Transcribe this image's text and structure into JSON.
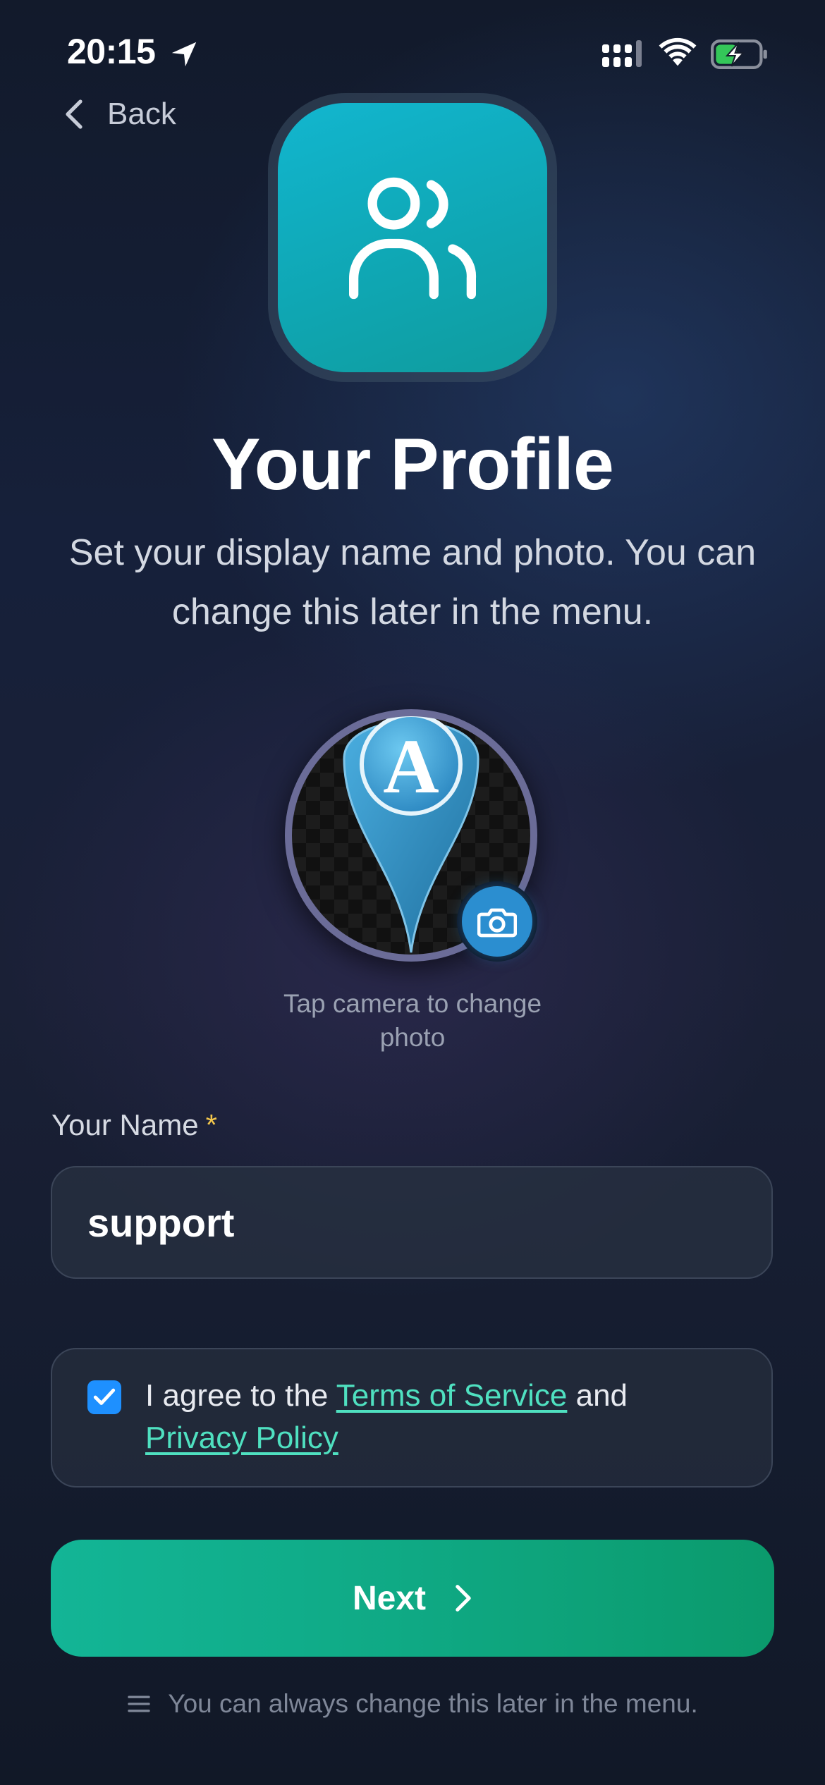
{
  "status_bar": {
    "time": "20:15"
  },
  "nav": {
    "back_label": "Back"
  },
  "header": {
    "title": "Your Profile",
    "subtitle": "Set your display name and photo. You can change this later in the menu."
  },
  "avatar": {
    "letter": "A",
    "hint": "Tap camera to change photo"
  },
  "name_field": {
    "label": "Your Name",
    "required_mark": "*",
    "value": "support"
  },
  "agreement": {
    "checked": true,
    "prefix": "I agree to the ",
    "terms_link": "Terms of Service",
    "middle": " and ",
    "privacy_link": "Privacy Policy"
  },
  "next_button": {
    "label": "Next"
  },
  "footer": {
    "text": "You can always change this later in the menu."
  },
  "colors": {
    "accent_teal": "#12b6cf",
    "button_green": "#0fa984",
    "link": "#4fe0c0",
    "required": "#f5c84c",
    "checkbox": "#1e90ff"
  },
  "icons": [
    "location-arrow-icon",
    "cellular-icon",
    "wifi-icon",
    "battery-charging-icon",
    "chevron-left-icon",
    "users-icon",
    "camera-icon",
    "check-icon",
    "chevron-right-icon",
    "menu-lines-icon"
  ]
}
